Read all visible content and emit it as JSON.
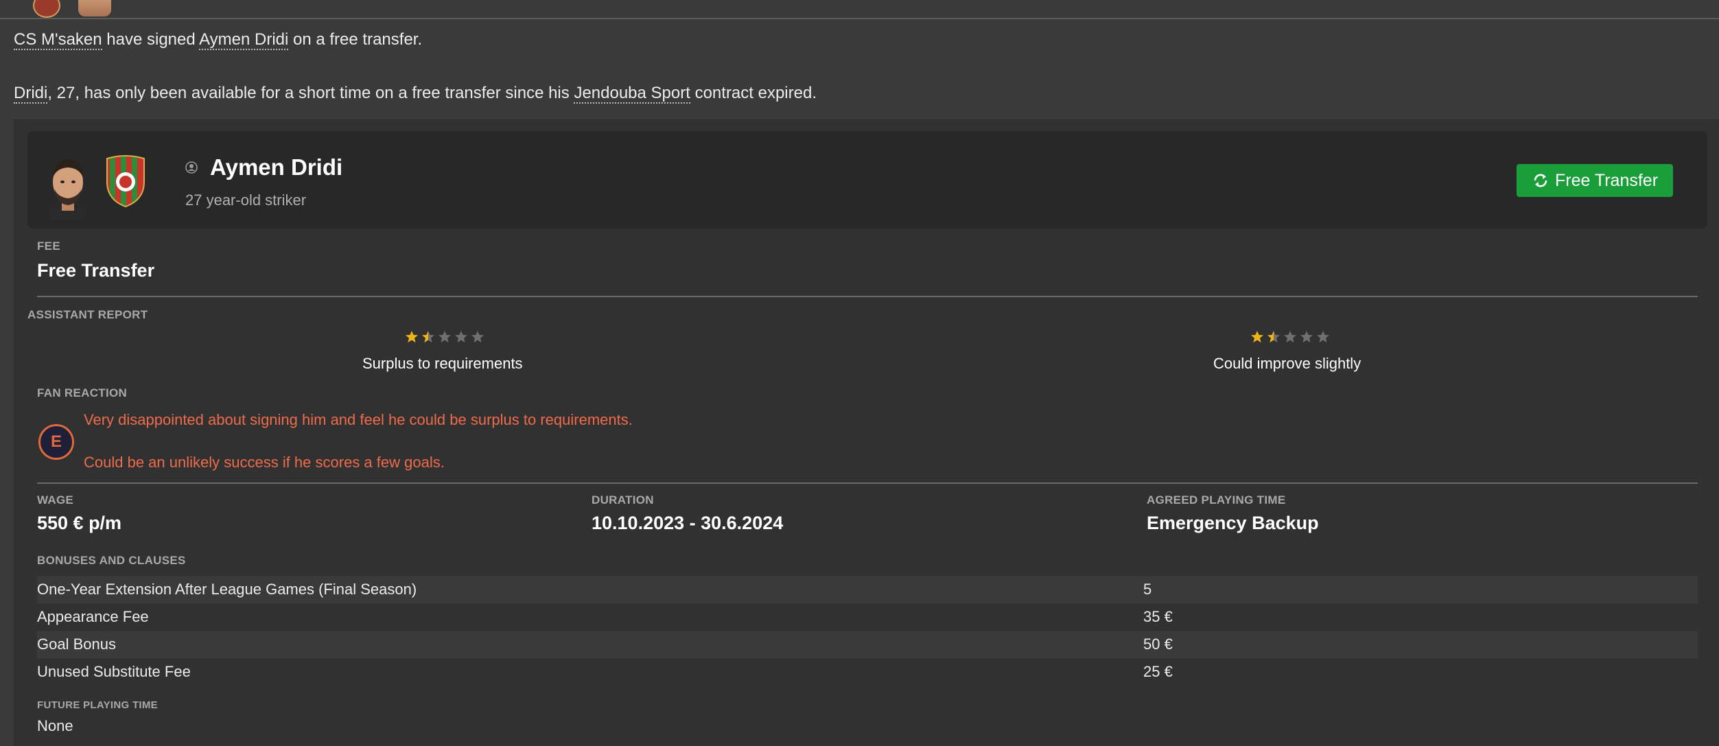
{
  "news": {
    "line1": {
      "club": "CS M'saken",
      "part1": " have signed ",
      "player": "Aymen Dridi",
      "part2": " on a free transfer."
    },
    "line2": {
      "player": "Dridi",
      "part1": ", 27, has only been available for a short time on a free transfer since his ",
      "club": "Jendouba Sport",
      "part2": " contract expired."
    }
  },
  "player": {
    "name": "Aymen Dridi",
    "subtitle": "27 year-old striker",
    "action_button": "Free Transfer"
  },
  "fee": {
    "label": "FEE",
    "value": "Free Transfer"
  },
  "assistant_report": {
    "label": "ASSISTANT REPORT",
    "ratings": [
      {
        "stars": 1.5,
        "text": "Surplus to requirements"
      },
      {
        "stars": 1.5,
        "text": "Could improve slightly"
      }
    ]
  },
  "fan_reaction": {
    "label": "FAN REACTION",
    "badge": "E",
    "lines": [
      "Very disappointed about signing him and feel he could be surplus to requirements.",
      "Could be an unlikely success if he scores a few goals."
    ]
  },
  "contract": {
    "wage": {
      "label": "WAGE",
      "value": "550 € p/m"
    },
    "duration": {
      "label": "DURATION",
      "value": "10.10.2023 - 30.6.2024"
    },
    "playing_time": {
      "label": "AGREED PLAYING TIME",
      "value": "Emergency Backup"
    }
  },
  "bonuses": {
    "label": "BONUSES AND CLAUSES",
    "rows": [
      {
        "label": "One-Year Extension After League Games (Final Season)",
        "value": "5"
      },
      {
        "label": "Appearance Fee",
        "value": "35 €"
      },
      {
        "label": "Goal Bonus",
        "value": "50 €"
      },
      {
        "label": "Unused Substitute Fee",
        "value": "25 €"
      }
    ]
  },
  "future_playing_time": {
    "label": "FUTURE PLAYING TIME",
    "value": "None"
  },
  "colors": {
    "accent_green": "#1a9e3a",
    "fan_text": "#ee6b4b",
    "star_gold": "#f0b21a",
    "star_empty": "#707070"
  }
}
